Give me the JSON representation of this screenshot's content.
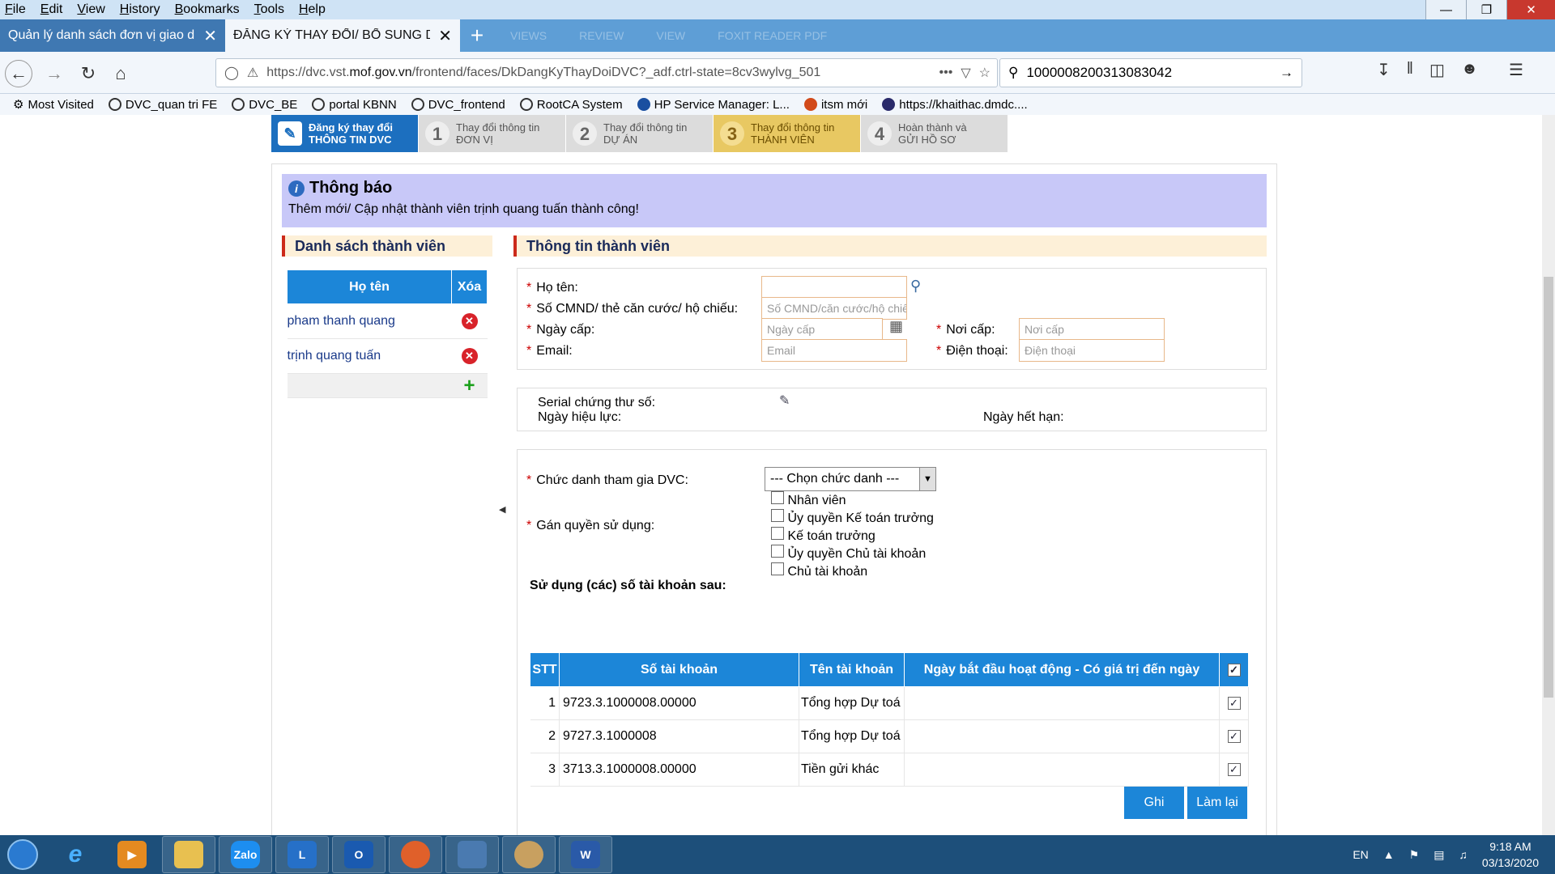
{
  "menu": [
    "File",
    "Edit",
    "View",
    "History",
    "Bookmarks",
    "Tools",
    "Help"
  ],
  "tabs": [
    {
      "label": "Quản lý danh sách đơn vị giao dịch",
      "active": false
    },
    {
      "label": "ĐĂNG KÝ THAY ĐỔI/ BỔ SUNG DỊCH",
      "active": true
    }
  ],
  "tab_ghosts": [
    "VIEWS",
    "REVIEW",
    "VIEW",
    "FOXIT READER PDF"
  ],
  "url": {
    "prefix": "https://dvc.vst.",
    "domain": "mof.gov.vn",
    "suffix": "/frontend/faces/DkDangKyThayDoiDVC?_adf.ctrl-state=8cv3wylvg_501"
  },
  "search_value": "1000008200313083042",
  "bookmarks": [
    "Most Visited",
    "DVC_quan tri FE",
    "DVC_BE",
    "portal KBNN",
    "DVC_frontend",
    "RootCA System",
    "HP Service Manager: L...",
    "itsm mới",
    "https://khaithac.dmdc...."
  ],
  "wizard": {
    "first": {
      "line1": "Đăng ký thay đổi",
      "line2": "THÔNG TIN DVC"
    },
    "steps": [
      {
        "num": "1",
        "line1": "Thay đổi thông tin",
        "line2": "ĐƠN VỊ",
        "current": false
      },
      {
        "num": "2",
        "line1": "Thay đổi thông tin",
        "line2": "DỰ ÁN",
        "current": false
      },
      {
        "num": "3",
        "line1": "Thay đổi thông tin",
        "line2": "THÀNH VIÊN",
        "current": true
      },
      {
        "num": "4",
        "line1": "Hoàn thành và",
        "line2": "GỬI HỒ SƠ",
        "current": false
      }
    ]
  },
  "notice": {
    "title": "Thông báo",
    "message": "Thêm mới/ Cập nhật thành viên trịnh quang tuấn thành công!"
  },
  "members": {
    "heading": "Danh sách thành viên",
    "col_name": "Họ tên",
    "col_delete": "Xóa",
    "rows": [
      "pham thanh quang",
      "trịnh quang tuấn"
    ]
  },
  "member_info": {
    "heading": "Thông tin thành viên",
    "ho_ten": {
      "label": "Họ tên:",
      "value": ""
    },
    "cmnd": {
      "label": "Số CMND/ thẻ căn cước/ hộ chiếu:",
      "placeholder": "Số CMND/căn cước/hộ chiếu"
    },
    "ngay_cap": {
      "label": "Ngày cấp:",
      "placeholder": "Ngày cấp"
    },
    "noi_cap": {
      "label": "Nơi cấp:",
      "placeholder": "Nơi cấp"
    },
    "email": {
      "label": "Email:",
      "placeholder": "Email"
    },
    "dien_thoai": {
      "label": "Điện thoại:",
      "placeholder": "Điện thoại"
    }
  },
  "certificate": {
    "serial_label": "Serial chứng thư số:",
    "valid_from_label": "Ngày hiệu lực:",
    "expiry_label": "Ngày hết hạn:"
  },
  "role": {
    "label": "Chức danh tham gia DVC:",
    "selected": "--- Chọn chức danh ---"
  },
  "permissions": {
    "label": "Gán quyền sử dụng:",
    "options": [
      "Nhân viên",
      "Ủy quyền Kế toán trưởng",
      "Kế toán trưởng",
      "Ủy quyền Chủ tài khoản",
      "Chủ tài khoản"
    ]
  },
  "accounts": {
    "heading": "Sử dụng (các) số tài khoản sau:",
    "columns": [
      "STT",
      "Số tài khoản",
      "Tên tài khoản",
      "Ngày bắt đầu hoạt động - Có giá trị đến ngày"
    ],
    "rows": [
      {
        "stt": "1",
        "so": "9723.3.1000008.00000",
        "ten": "Tổng hợp Dự toá",
        "ngay": ""
      },
      {
        "stt": "2",
        "so": "9727.3.1000008",
        "ten": "Tổng hợp Dự toá",
        "ngay": ""
      },
      {
        "stt": "3",
        "so": "3713.3.1000008.00000",
        "ten": "Tiền gửi khác",
        "ngay": ""
      }
    ]
  },
  "buttons": {
    "save": "Ghi",
    "reset": "Làm lại"
  },
  "taskbar": {
    "lang": "EN",
    "time": "9:18 AM",
    "date": "03/13/2020"
  },
  "colors": {
    "accent": "#1c86d8",
    "notice_bg": "#c8c8f8",
    "section_bg": "#fdf0d8",
    "wizard_current": "#e8c862"
  }
}
